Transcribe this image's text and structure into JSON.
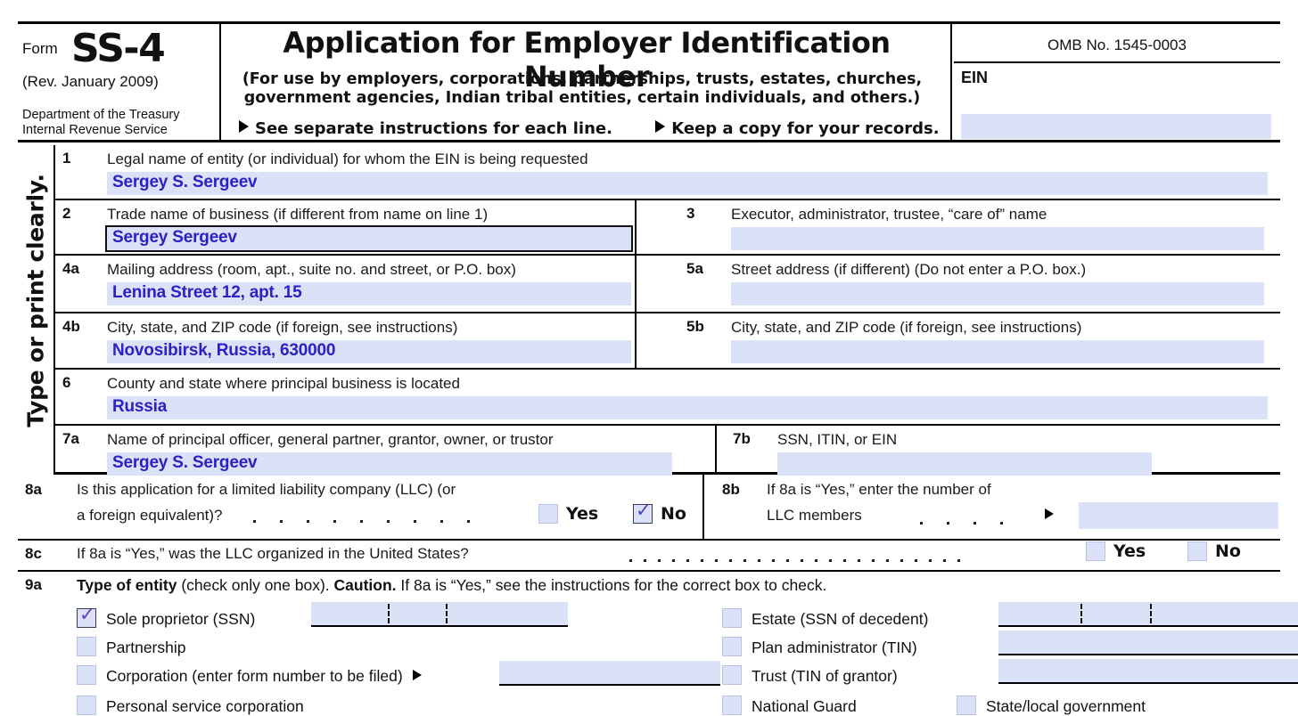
{
  "header": {
    "form_word": "Form",
    "form_name": "SS-4",
    "revision": "(Rev. January 2009)",
    "department_line1": "Department of the Treasury",
    "department_line2": "Internal Revenue Service",
    "title": "Application for Employer Identification Number",
    "subtitle_line1": "(For use by employers, corporations, partnerships, trusts, estates, churches,",
    "subtitle_line2": "government agencies, Indian tribal entities, certain individuals, and others.)",
    "note1": "See separate instructions for each line.",
    "note2": "Keep a copy for your records.",
    "omb": "OMB No. 1545-0003",
    "ein_label": "EIN",
    "ein_value": ""
  },
  "side_caption": "Type or print clearly.",
  "lines": {
    "l1": {
      "num": "1",
      "label": "Legal name of entity (or individual) for whom the EIN is being requested",
      "value": "Sergey S. Sergeev"
    },
    "l2": {
      "num": "2",
      "label": "Trade name of business (if different from name on line 1)",
      "value": "Sergey Sergeev"
    },
    "l3": {
      "num": "3",
      "label": "Executor, administrator, trustee, “care of” name",
      "value": ""
    },
    "l4a": {
      "num": "4a",
      "label": "Mailing address (room, apt., suite no. and street, or P.O. box)",
      "value": "Lenina Street 12, apt. 15"
    },
    "l5a": {
      "num": "5a",
      "label": "Street address (if different) (Do not enter a P.O. box.)",
      "value": ""
    },
    "l4b": {
      "num": "4b",
      "label": "City, state, and ZIP code (if foreign, see instructions)",
      "value": "Novosibirsk, Russia, 630000"
    },
    "l5b": {
      "num": "5b",
      "label": "City, state, and ZIP code (if foreign, see instructions)",
      "value": ""
    },
    "l6": {
      "num": "6",
      "label": "County and state where principal business is located",
      "value": "Russia"
    },
    "l7a": {
      "num": "7a",
      "label": "Name of principal officer, general partner, grantor, owner, or trustor",
      "value": "Sergey S. Sergeev"
    },
    "l7b": {
      "num": "7b",
      "label": "SSN, ITIN, or EIN",
      "value": ""
    }
  },
  "line8a": {
    "num": "8a",
    "label_line1": "Is this application for a limited liability company (LLC) (or",
    "label_line2": "a foreign equivalent)?",
    "yes_label": "Yes",
    "no_label": "No",
    "yes_checked": false,
    "no_checked": true
  },
  "line8b": {
    "num": "8b",
    "label_line1": "If 8a is “Yes,” enter the number of",
    "label_line2": "LLC members",
    "value": ""
  },
  "line8c": {
    "num": "8c",
    "label": "If 8a is “Yes,” was the LLC organized in the United States?",
    "yes_label": "Yes",
    "no_label": "No",
    "yes_checked": false,
    "no_checked": false
  },
  "line9a": {
    "num": "9a",
    "heading_bold1": "Type of entity",
    "heading_mid": " (check only one box). ",
    "heading_bold2": "Caution.",
    "heading_tail": " If 8a is “Yes,” see the instructions for the correct box to check.",
    "left_options": [
      {
        "label": "Sole proprietor (SSN)",
        "checked": true,
        "field": "segmented",
        "value": ""
      },
      {
        "label": "Partnership",
        "checked": false,
        "field": "none",
        "value": ""
      },
      {
        "label": "Corporation (enter form number to be filed)",
        "checked": false,
        "field": "arrow-plain",
        "value": ""
      },
      {
        "label": "Personal service corporation",
        "checked": false,
        "field": "none",
        "value": ""
      }
    ],
    "right_options": [
      {
        "label": "Estate (SSN of decedent)",
        "checked": false,
        "field": "segmented",
        "value": ""
      },
      {
        "label": "Plan administrator (TIN)",
        "checked": false,
        "field": "plain",
        "value": ""
      },
      {
        "label": "Trust (TIN of grantor)",
        "checked": false,
        "field": "plain",
        "value": ""
      },
      {
        "label": "National Guard",
        "checked": false,
        "field": "none",
        "value": ""
      }
    ],
    "extra_option": {
      "label": "State/local government",
      "checked": false
    }
  },
  "colors": {
    "field_fill": "#dbe1f7",
    "entry_text": "#2b21c4",
    "check_mark": "#5b3fc4",
    "rule": "#000000"
  }
}
